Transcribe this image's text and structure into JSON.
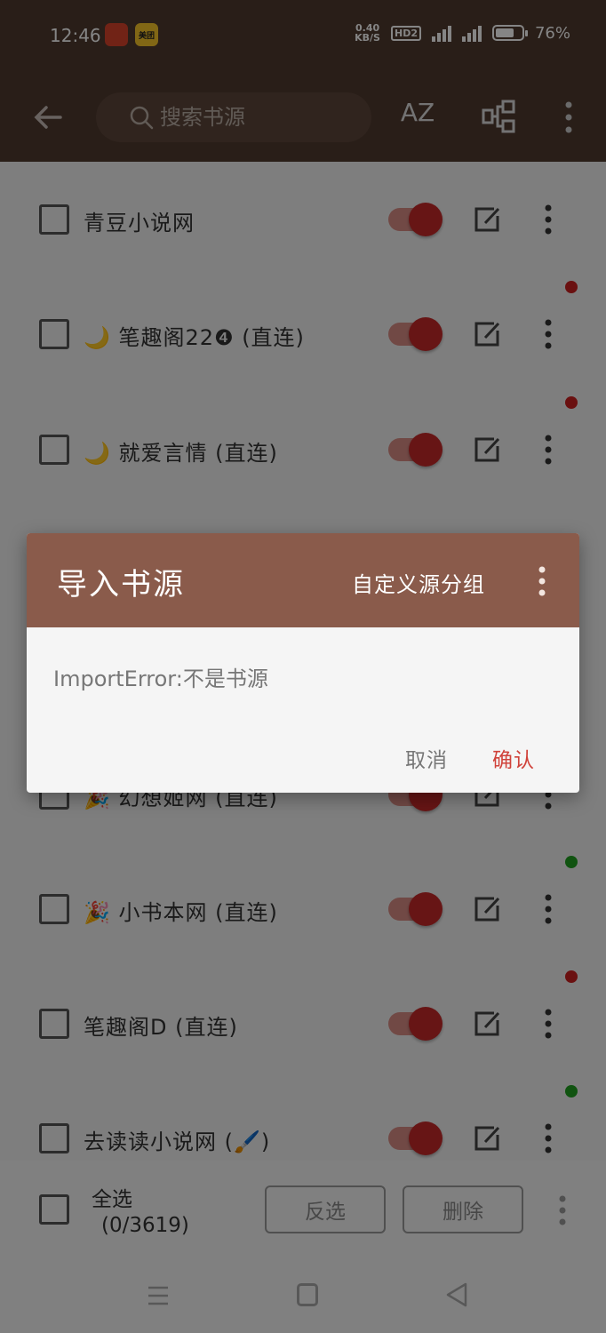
{
  "status_bar": {
    "time": "12:46",
    "app_icon_2_text": "美团",
    "net_speed_value": "0.40",
    "net_speed_unit": "KB/S",
    "hd_badge": "HD2",
    "battery_percent": "76%",
    "battery_level": 0.76
  },
  "app_bar": {
    "search_placeholder": "搜索书源",
    "sort_label": "AZ"
  },
  "sources": [
    {
      "label": "青豆小说网",
      "enabled": true,
      "dot": null
    },
    {
      "label": "🌙 笔趣阁22❹ (直连)",
      "enabled": true,
      "dot": "#cc1f1f"
    },
    {
      "label": "🌙 就爱言情 (直连)",
      "enabled": true,
      "dot": "#cc1f1f"
    },
    {
      "label": "",
      "enabled": true,
      "dot": null
    },
    {
      "label": "",
      "enabled": true,
      "dot": null
    },
    {
      "label": "🎉 幻想姬网 (直连)",
      "enabled": true,
      "dot": null
    },
    {
      "label": "🎉 小书本网 (直连)",
      "enabled": true,
      "dot": "#20a020"
    },
    {
      "label": "笔趣阁D (直连)",
      "enabled": true,
      "dot": "#cc1f1f"
    },
    {
      "label": "去读读小说网 (🖌️)",
      "enabled": true,
      "dot": "#20a020"
    }
  ],
  "bottom_bar": {
    "select_all": "全选",
    "count": "(0/3619)",
    "invert": "反选",
    "delete": "删除"
  },
  "dialog": {
    "title": "导入书源",
    "group_button": "自定义源分组",
    "message": "ImportError:不是书源",
    "cancel": "取消",
    "confirm": "确认"
  },
  "colors": {
    "toolbar": "#4f3a2f",
    "dialog_header": "#8a5b4b",
    "accent": "#c62a2a",
    "confirm": "#d0423a"
  }
}
